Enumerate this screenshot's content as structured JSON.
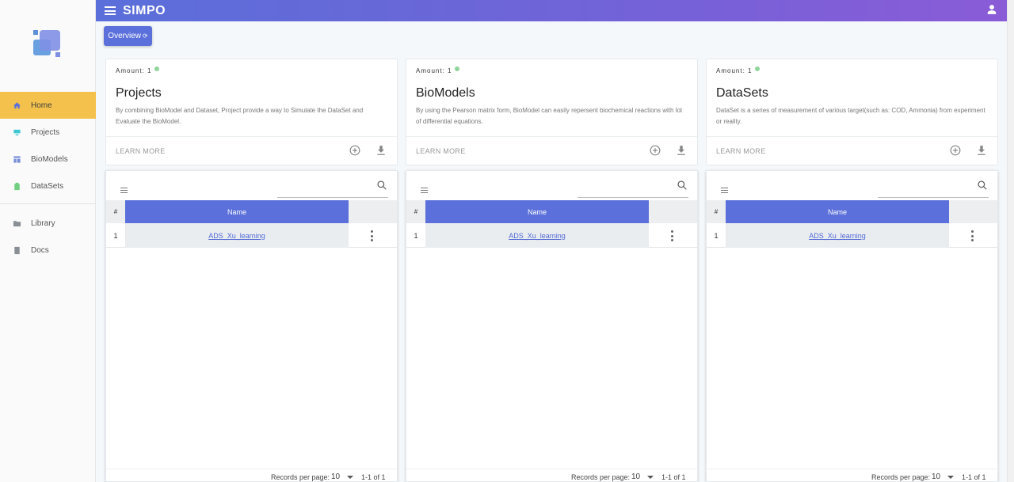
{
  "app": {
    "title": "SIMPO"
  },
  "sidebar": {
    "items": [
      {
        "label": "Home",
        "icon": "home-icon"
      },
      {
        "label": "Projects",
        "icon": "projects-icon"
      },
      {
        "label": "BioModels",
        "icon": "biomodels-icon"
      },
      {
        "label": "DataSets",
        "icon": "datasets-icon"
      },
      {
        "label": "Library",
        "icon": "folder-icon"
      },
      {
        "label": "Docs",
        "icon": "book-icon"
      }
    ]
  },
  "toolbar": {
    "overview_label": "Overview",
    "overview_icon": "refresh-icon"
  },
  "cards": [
    {
      "amount": "Amount: 1",
      "title": "Projects",
      "description": "By combining BioModel and Dataset, Project provide a way to Simulate the DataSet and Evaluate the BioModel.",
      "action": "LEARN MORE"
    },
    {
      "amount": "Amount: 1",
      "title": "BioModels",
      "description": "By using the Pearson matrix form, BioModel can easily repersent biochemical reactions with lot of differential equations.",
      "action": "LEARN MORE"
    },
    {
      "amount": "Amount: 1",
      "title": "DataSets",
      "description": "DataSet is a series of measurement of various target(such as: COD, Ammonia) from experiment or reality.",
      "action": "LEARN MORE"
    }
  ],
  "tables": [
    {
      "columns": {
        "index": "#",
        "name": "Name"
      },
      "rows": [
        {
          "index": "1",
          "name": "ADS_Xu_learning"
        }
      ],
      "footer": {
        "records_label": "Records per page:",
        "records_value": "10",
        "range": "1-1 of 1"
      }
    },
    {
      "columns": {
        "index": "#",
        "name": "Name"
      },
      "rows": [
        {
          "index": "1",
          "name": "ADS_Xu_learning"
        }
      ],
      "footer": {
        "records_label": "Records per page:",
        "records_value": "10",
        "range": "1-1 of 1"
      }
    },
    {
      "columns": {
        "index": "#",
        "name": "Name"
      },
      "rows": [
        {
          "index": "1",
          "name": "ADS_Xu_learning"
        }
      ],
      "footer": {
        "records_label": "Records per page:",
        "records_value": "10",
        "range": "1-1 of 1"
      }
    }
  ],
  "colors": {
    "accent": "#5b70da",
    "active_nav": "#f4c24c",
    "status_dot": "#8fd49b"
  }
}
